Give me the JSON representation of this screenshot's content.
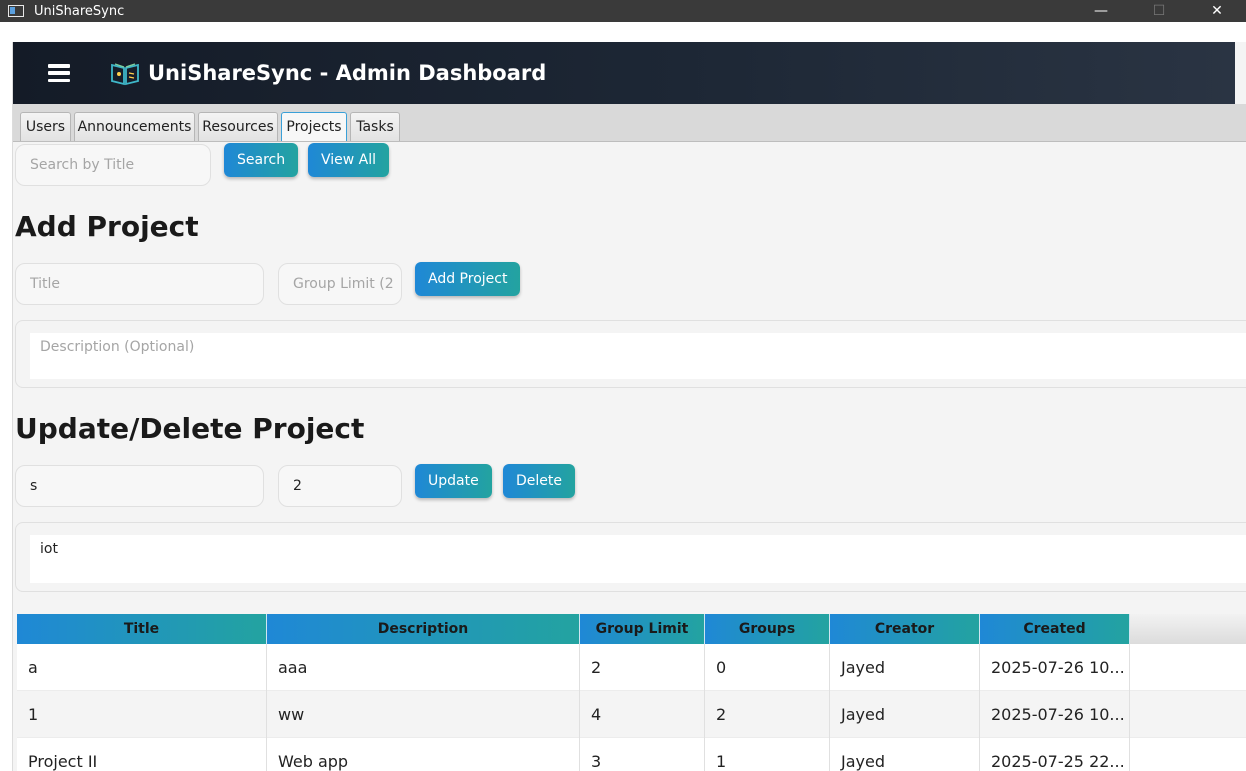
{
  "window": {
    "title": "UniShareSync",
    "controls": {
      "minimize": "—",
      "maximize": "☐",
      "close": "✕"
    }
  },
  "header": {
    "title": "UniShareSync - Admin Dashboard"
  },
  "tabs": [
    {
      "label": "Users"
    },
    {
      "label": "Announcements"
    },
    {
      "label": "Resources"
    },
    {
      "label": "Projects",
      "active": true
    },
    {
      "label": "Tasks"
    }
  ],
  "search": {
    "placeholder": "Search by Title",
    "value": "",
    "search_label": "Search",
    "view_all_label": "View All"
  },
  "add_project": {
    "heading": "Add Project",
    "title_placeholder": "Title",
    "group_limit_placeholder": "Group Limit (2",
    "button_label": "Add Project",
    "description_placeholder": "Description (Optional)"
  },
  "update_project": {
    "heading": "Update/Delete Project",
    "title_value": "s",
    "group_limit_value": "2",
    "update_label": "Update",
    "delete_label": "Delete",
    "description_value": "iot"
  },
  "table": {
    "columns": [
      "Title",
      "Description",
      "Group Limit",
      "Groups",
      "Creator",
      "Created"
    ],
    "rows": [
      [
        "a",
        "aaa",
        "2",
        "0",
        "Jayed",
        "2025-07-26 10..."
      ],
      [
        "1",
        "ww",
        "4",
        "2",
        "Jayed",
        "2025-07-26 10..."
      ],
      [
        "Project II",
        "Web app",
        "3",
        "1",
        "Jayed",
        "2025-07-25 22..."
      ]
    ]
  },
  "colors": {
    "accent_start": "#1f88d6",
    "accent_end": "#23a3a0",
    "header_bg": "#1a2230"
  },
  "icons": {
    "menu": "hamburger-icon",
    "logo": "book-icon"
  }
}
